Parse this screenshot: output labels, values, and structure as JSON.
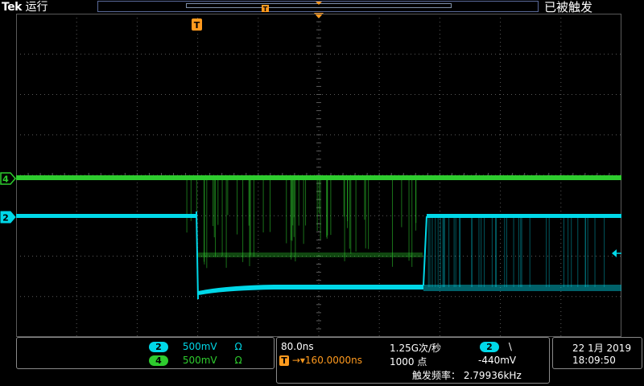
{
  "header": {
    "brand": "Tek",
    "run_state": "运行",
    "trigger_status": "已被触发"
  },
  "markers": {
    "trigger_label": "T",
    "ch4_label": "4",
    "ch2_label": "2"
  },
  "channels": [
    {
      "id": "2",
      "scale": "500mV",
      "impedance": "Ω",
      "color": "#00d8e8"
    },
    {
      "id": "4",
      "scale": "500mV",
      "impedance": "Ω",
      "color": "#2ecc2e"
    }
  ],
  "acquisition": {
    "time_per_div": "80.0ns",
    "sample_rate": "1.25G次/秒",
    "trigger_position": "160.0000ns",
    "record_length": "1000 点",
    "trigger_source": "2",
    "trigger_slope": "\\",
    "trigger_level": "-440mV",
    "trigger_freq_label": "触发频率：",
    "trigger_freq_value": "2.79936kHz"
  },
  "datetime": {
    "date": "22 1月 2019",
    "time": "18:09:50"
  },
  "colors": {
    "ch2": "#00d8e8",
    "ch4": "#2ecc2e",
    "trigger": "#ff9a1e",
    "grid": "#5a5a5a"
  }
}
